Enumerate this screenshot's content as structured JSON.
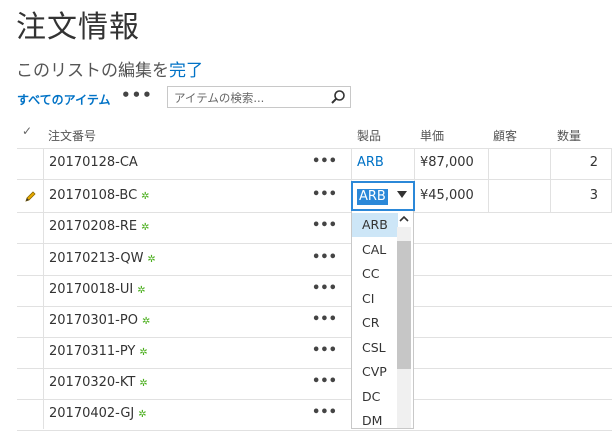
{
  "page": {
    "title": "注文情報",
    "subtitle_prefix": "このリストの編集を",
    "subtitle_link": "完了"
  },
  "toolbar": {
    "view_label": "すべてのアイテム",
    "more_label": "•••",
    "search_placeholder": "アイテムの検索..."
  },
  "columns": {
    "check": "✓",
    "order_no": "注文番号",
    "product": "製品",
    "unit_price": "単価",
    "customer": "顧客",
    "quantity": "数量"
  },
  "rows": [
    {
      "order_no": "20170128-CA",
      "is_new": false,
      "product": "ARB",
      "unit_price": "¥87,000",
      "quantity": "2",
      "more": "•••"
    },
    {
      "order_no": "20170108-BC",
      "is_new": true,
      "product": "ARB",
      "unit_price": "¥45,000",
      "quantity": "3",
      "more": "•••",
      "editing": true,
      "edit_icon": "pencil-icon"
    },
    {
      "order_no": "20170208-RE",
      "is_new": true,
      "more": "•••"
    },
    {
      "order_no": "20170213-QW",
      "is_new": true,
      "more": "•••"
    },
    {
      "order_no": "20170018-UI",
      "is_new": true,
      "more": "•••"
    },
    {
      "order_no": "20170301-PO",
      "is_new": true,
      "more": "•••"
    },
    {
      "order_no": "20170311-PY",
      "is_new": true,
      "more": "•••"
    },
    {
      "order_no": "20170320-KT",
      "is_new": true,
      "more": "•••"
    },
    {
      "order_no": "20170402-GJ",
      "is_new": true,
      "more": "•••"
    }
  ],
  "new_marker": "✲",
  "dropdown": {
    "selected": "ARB",
    "options": [
      "ARB",
      "CAL",
      "CC",
      "CI",
      "CR",
      "CSL",
      "CVP",
      "DC",
      "DM"
    ]
  },
  "colors": {
    "accent": "#0072c6",
    "selection": "#2b88d8",
    "new_marker": "#4caf1f"
  }
}
